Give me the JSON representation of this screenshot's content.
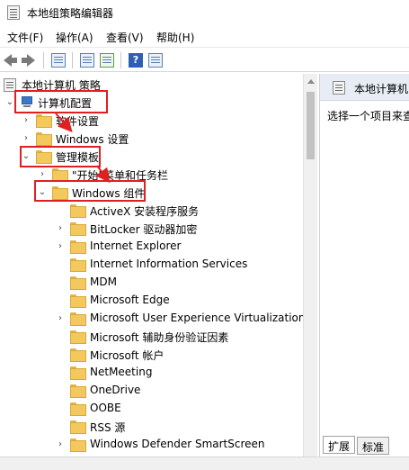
{
  "window": {
    "title": "本地组策略编辑器"
  },
  "menu": [
    "文件(F)",
    "操作(A)",
    "查看(V)",
    "帮助(H)"
  ],
  "toolbar": {
    "icons": [
      "back-icon",
      "forward-icon",
      "show-hide-tree-icon",
      "properties-icon",
      "export-list-icon",
      "help-icon",
      "view-icon"
    ],
    "help_glyph": "?"
  },
  "tree": {
    "root": "本地计算机 策略",
    "computer_config": "计算机配置",
    "software_settings": "软件设置",
    "windows_settings": "Windows 设置",
    "admin_templates": "管理模板",
    "start_menu": "\"开始\"菜单和任务栏",
    "windows_components": "Windows 组件",
    "components": [
      "ActiveX 安装程序服务",
      "BitLocker 驱动器加密",
      "Internet Explorer",
      "Internet Information Services",
      "MDM",
      "Microsoft Edge",
      "Microsoft User Experience Virtualization",
      "Microsoft 辅助身份验证因素",
      "Microsoft 帐户",
      "NetMeeting",
      "OneDrive",
      "OOBE",
      "RSS 源",
      "Windows Defender SmartScreen"
    ]
  },
  "right_pane": {
    "title": "本地计算机",
    "hint": "选择一个项目来查"
  },
  "tabs": [
    "扩展",
    "标准"
  ],
  "colors": {
    "annotation": "#e02020",
    "folder": "#f3c95d",
    "header_bg": "#e7ecf5"
  }
}
